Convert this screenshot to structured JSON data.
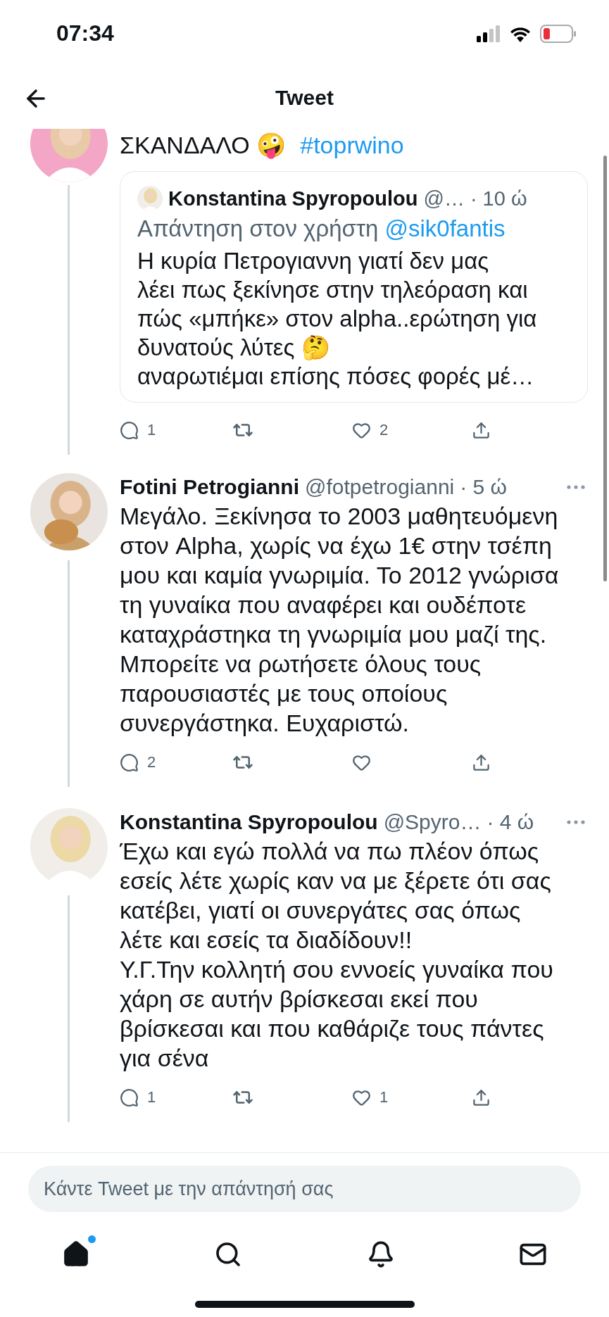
{
  "status_bar": {
    "time": "07:34"
  },
  "header": {
    "title": "Tweet"
  },
  "top_tweet": {
    "text_parts": [
      {
        "kind": "plain",
        "text": "ΣΚΑΝΔΑΛΟ 🤪"
      },
      {
        "kind": "hashtag",
        "text": "#toprwino"
      }
    ],
    "quote": {
      "name": "Konstantina Spyropoulou",
      "handle": "@…",
      "time": "· 10 ώ",
      "reply_label": "Απάντηση στον χρήστη",
      "reply_to": "@sik0fantis",
      "lines": [
        "Η κυρία Πετρογιαννη γιατί δεν μας",
        "λέει πως ξεκίνησε στην τηλεόραση και",
        "πώς «μπήκε» στον alpha..ερώτηση για",
        "δυνατούς λύτες 🤔",
        "αναρωτιέμαι επίσης πόσες φορές μέ…"
      ]
    },
    "actions": {
      "replies": "1",
      "likes": "2"
    }
  },
  "tweets": [
    {
      "name": "Fotini Petrogianni",
      "handle": "@fotpetrogianni",
      "time": "· 5 ώ",
      "lines": [
        "Μεγάλο. Ξεκίνησα το 2003 μαθητευόμενη",
        "στον Alpha, χωρίς να έχω 1€ στην τσέπη",
        "μου και καμία γνωριμία. Το 2012 γνώρισα",
        "τη γυναίκα που αναφέρει και ουδέποτε",
        "καταχράστηκα τη γνωριμία μου μαζί της.",
        "Μπορείτε να ρωτήσετε όλους τους",
        "παρουσιαστές με τους οποίους",
        "συνεργάστηκα. Ευχαριστώ."
      ],
      "actions": {
        "replies": "2"
      }
    },
    {
      "name": "Konstantina Spyropoulou",
      "handle": "@Spyro…",
      "time": "· 4 ώ",
      "lines": [
        "Έχω και εγώ πολλά να πω πλέον όπως",
        "εσείς λέτε χωρίς καν να με ξέρετε ότι σας",
        "κατέβει, γιατί οι συνεργάτες σας όπως",
        "λέτε και εσείς τα διαδίδουν!!",
        "Υ.Γ.Την κολλητή σου εννοείς γυναίκα που",
        "χάρη σε αυτήν βρίσκεσαι εκεί που",
        "βρίσκεσαι και που καθάριζε τους πάντες",
        "για σένα"
      ],
      "actions": {
        "replies": "1",
        "likes": "1"
      }
    }
  ],
  "reply_bar": {
    "placeholder": "Κάντε Tweet με την απάντησή σας"
  },
  "tab_bar": [
    {
      "kind": "home",
      "selected": true,
      "badge": true
    },
    {
      "kind": "search",
      "selected": false,
      "badge": false
    },
    {
      "kind": "notifications",
      "selected": false,
      "badge": false
    },
    {
      "kind": "messages",
      "selected": false,
      "badge": false
    }
  ]
}
